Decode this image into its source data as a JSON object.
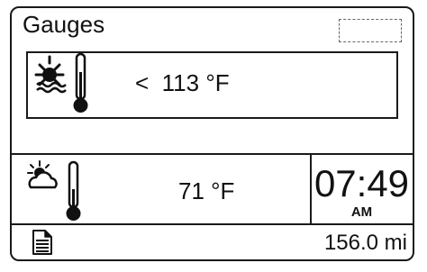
{
  "header": {
    "title": "Gauges"
  },
  "coolant": {
    "icon": "engine-coolant-temperature-icon",
    "prefix": "<",
    "value": "113",
    "unit": "°F"
  },
  "outside": {
    "icon": "outside-air-temperature-icon",
    "value": "71",
    "unit": "°F"
  },
  "clock": {
    "time": "07:49",
    "ampm": "AM"
  },
  "trip": {
    "icon": "document-icon",
    "distance": "156.0 mi"
  }
}
